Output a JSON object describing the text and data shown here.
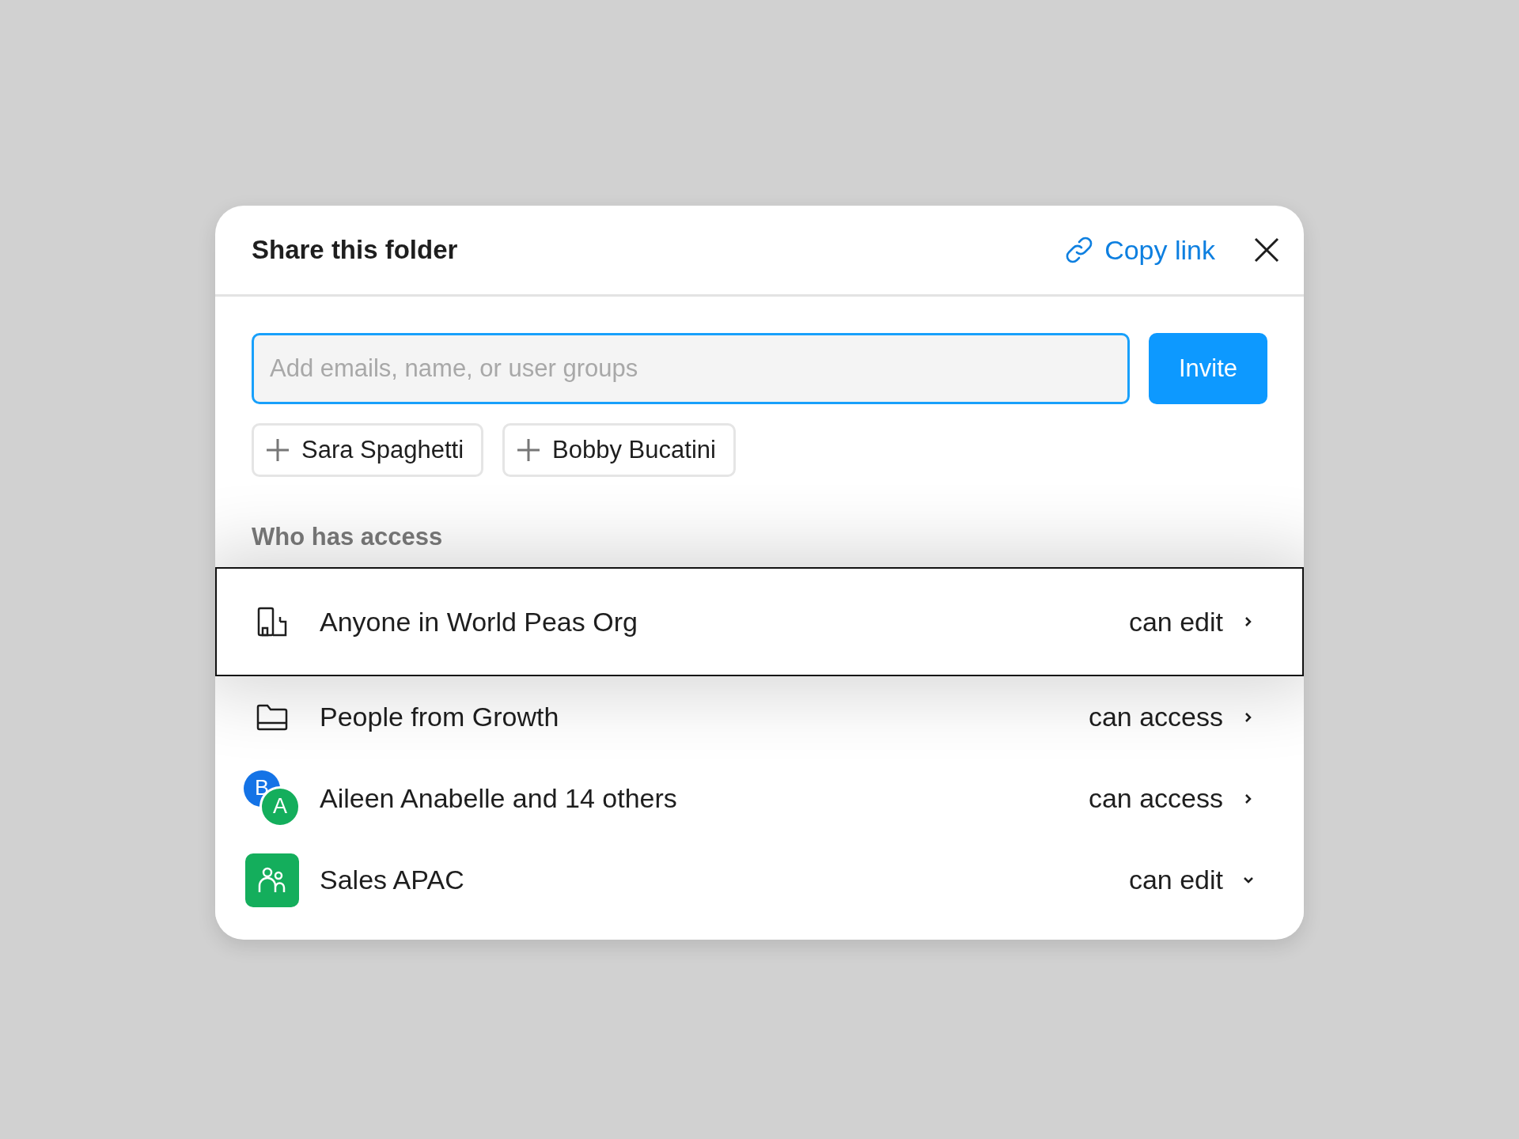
{
  "dialog": {
    "title": "Share this folder",
    "copy_link": "Copy link"
  },
  "invite": {
    "placeholder": "Add emails, name, or user groups",
    "button": "Invite"
  },
  "suggestions": [
    "Sara Spaghetti",
    "Bobby Bucatini"
  ],
  "access": {
    "heading": "Who has access",
    "rows": [
      {
        "kind": "building",
        "name": "Anyone in World Peas Org",
        "permission": "can edit",
        "selected": true,
        "expanded": false
      },
      {
        "kind": "folder",
        "name": "People from Growth",
        "permission": "can access",
        "selected": false,
        "expanded": false
      },
      {
        "kind": "avatars",
        "avatars": [
          {
            "letter": "B",
            "color": "#1473e6"
          },
          {
            "letter": "A",
            "color": "#14ae5c"
          }
        ],
        "name": "Aileen Anabelle and 14 others",
        "permission": "can access",
        "selected": false,
        "expanded": false
      },
      {
        "kind": "group",
        "color": "#14ae5c",
        "name": "Sales APAC",
        "permission": "can edit",
        "selected": false,
        "expanded": true
      }
    ]
  }
}
